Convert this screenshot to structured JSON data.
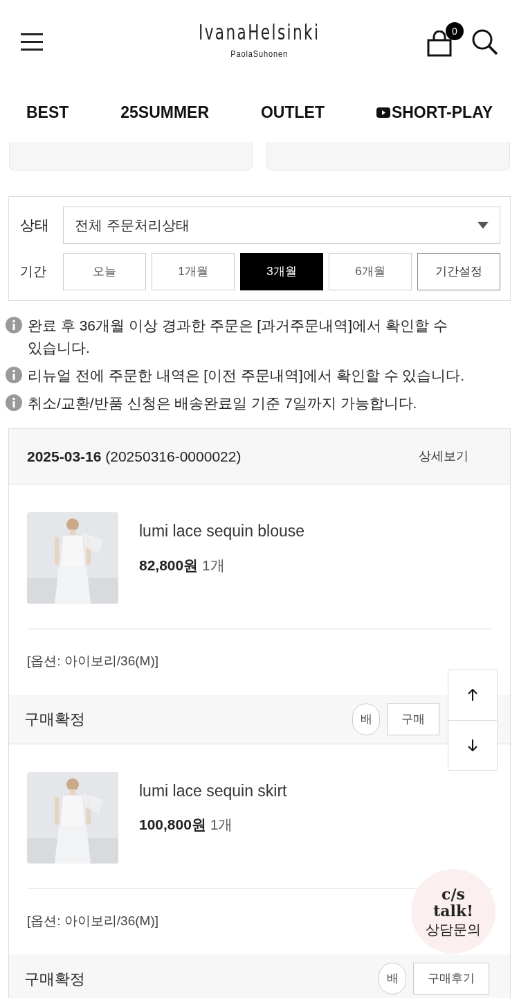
{
  "header": {
    "logo": "IvanaHelsinki",
    "logo_sub": "PaolaSuhonen",
    "cart_count": "0"
  },
  "nav": [
    {
      "label": "BEST",
      "kind": "text"
    },
    {
      "label": "25SUMMER",
      "kind": "text"
    },
    {
      "label": "OUTLET",
      "kind": "text"
    },
    {
      "label": "SHORT-PLAY",
      "kind": "video"
    }
  ],
  "filter": {
    "status_label": "상태",
    "status_value": "전체 주문처리상태",
    "period_label": "기간",
    "periods": [
      {
        "label": "오늘",
        "selected": false,
        "kind": "preset"
      },
      {
        "label": "1개월",
        "selected": false,
        "kind": "preset"
      },
      {
        "label": "3개월",
        "selected": true,
        "kind": "preset"
      },
      {
        "label": "6개월",
        "selected": false,
        "kind": "preset"
      },
      {
        "label": "기간설정",
        "selected": false,
        "kind": "custom"
      }
    ]
  },
  "notes": [
    "완료 후 36개월 이상 경과한 주문은 [과거주문내역]에서 확인할 수 있습니다.",
    "리뉴얼 전에 주문한 내역은 [이전 주문내역]에서 확인할 수 있습니다.",
    "취소/교환/반품 신청은 배송완료일 기준 7일까지 가능합니다."
  ],
  "order": {
    "date": "2025-03-16",
    "number": "(20250316-0000022)",
    "detail_link": "상세보기",
    "items": [
      {
        "name": "lumi lace sequin blouse",
        "price": "82,800원",
        "qty": "1개",
        "option": "[옵션: 아이보리/36(M)]",
        "status": "구매확정",
        "buttons": [
          "배",
          "구매"
        ]
      },
      {
        "name": "lumi lace sequin skirt",
        "price": "100,800원",
        "qty": "1개",
        "option": "[옵션: 아이보리/36(M)]",
        "status": "구매확정",
        "buttons": [
          "배",
          "구매후기"
        ]
      }
    ]
  },
  "cs_talk": {
    "title": "c/s",
    "subtitle": "talk!",
    "label": "상담문의"
  }
}
